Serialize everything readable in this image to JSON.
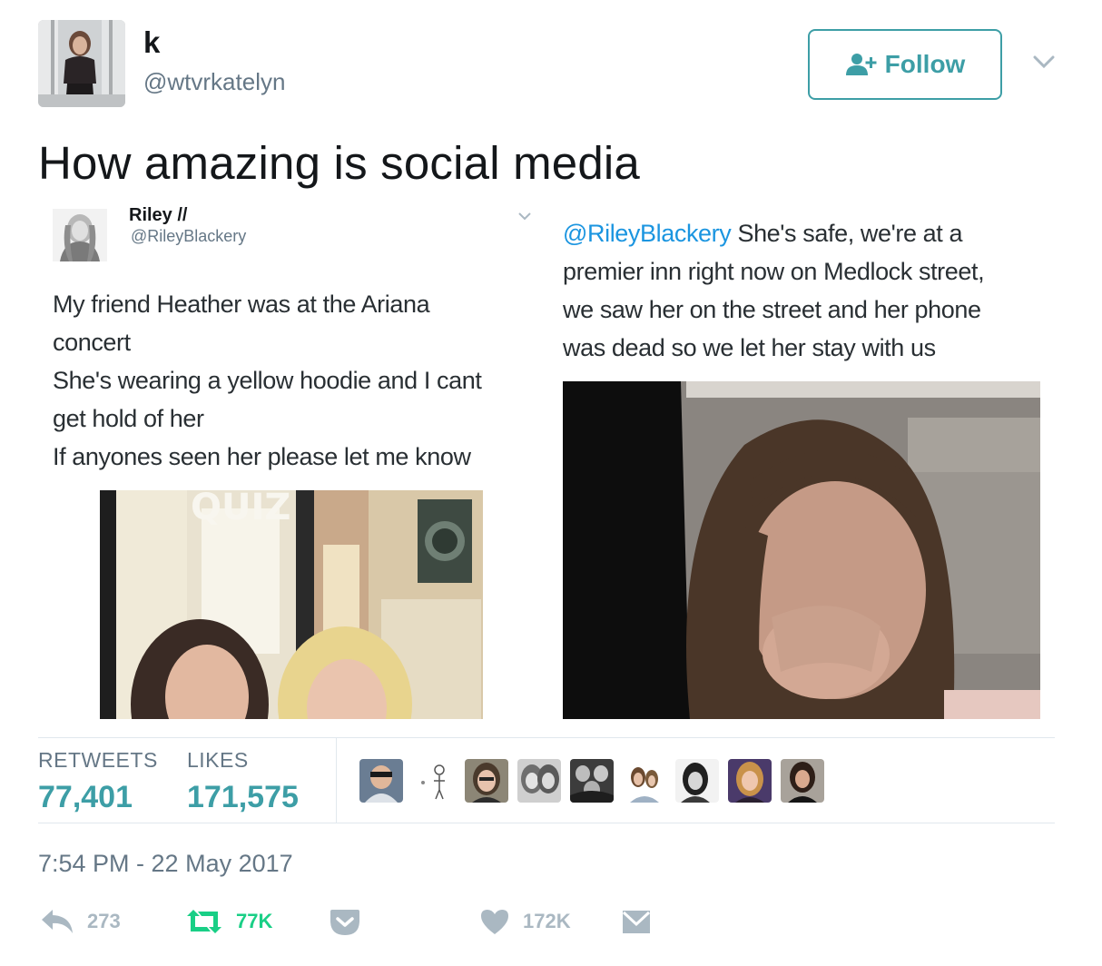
{
  "header": {
    "display_name": "k",
    "handle": "@wtvrkatelyn",
    "follow_label": "Follow"
  },
  "tweet": {
    "text": "How amazing is social media"
  },
  "embedded_left": {
    "name": "Riley //",
    "handle": "@RileyBlackery",
    "lines": [
      "My friend Heather was at the Ariana",
      "concert",
      "She's wearing a yellow hoodie and I cant",
      "get hold of her",
      "If anyones seen her please let me know"
    ],
    "photo_sign": "QUIZ"
  },
  "embedded_right": {
    "mention": "@RileyBlackery",
    "first_line_rest": " She's safe, we're at a",
    "lines": [
      "premier inn right now on Medlock street,",
      "we saw her on the street and her phone",
      "was dead so we let her stay with us"
    ]
  },
  "stats": {
    "retweets_label": "RETWEETS",
    "retweets_value": "77,401",
    "likes_label": "LIKES",
    "likes_value": "171,575"
  },
  "timestamp": "7:54 PM - 22 May 2017",
  "actions": {
    "reply_count": "273",
    "retweet_count": "77K",
    "like_count": "172K"
  },
  "colors": {
    "accent": "#3d9ea6",
    "retweet_green": "#19cf86",
    "muted": "#657786",
    "icon_gray": "#aab8c2",
    "link_blue": "#1b95e0"
  },
  "icons": {
    "follow": "add-user-icon",
    "caret": "chevron-down-icon",
    "reply": "reply-icon",
    "retweet": "retweet-icon",
    "pocket": "pocket-icon",
    "like": "heart-icon",
    "dm": "envelope-icon"
  }
}
